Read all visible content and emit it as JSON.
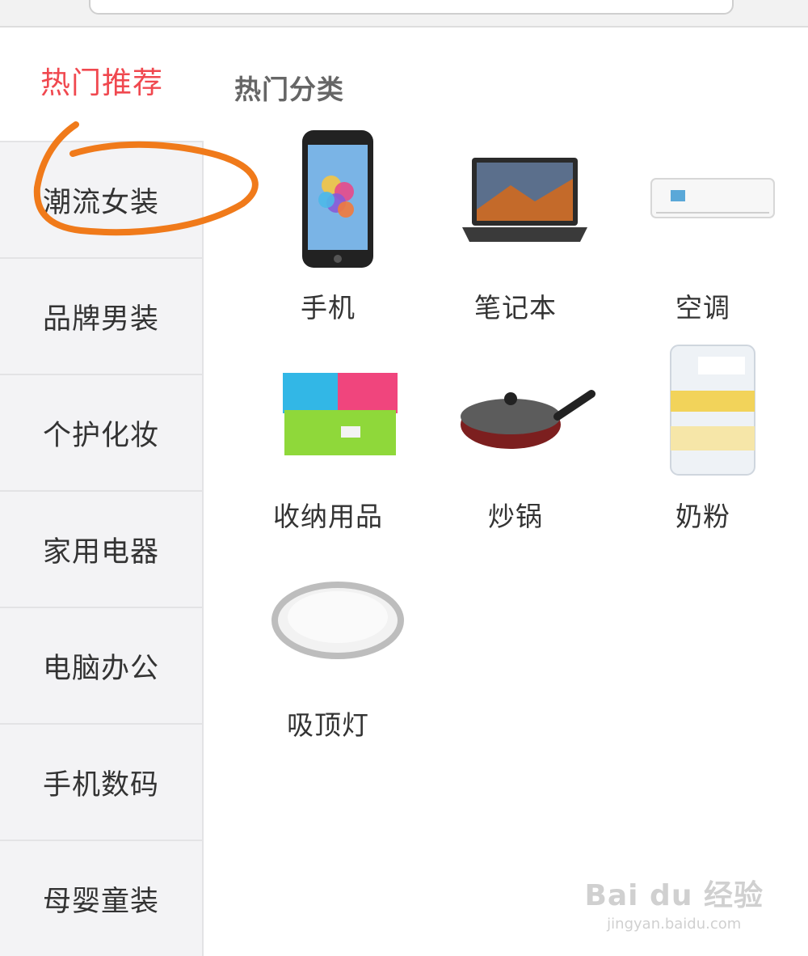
{
  "sidebar": {
    "active": "热门推荐",
    "items": [
      {
        "label": "潮流女装"
      },
      {
        "label": "品牌男装"
      },
      {
        "label": "个护化妆"
      },
      {
        "label": "家用电器"
      },
      {
        "label": "电脑办公"
      },
      {
        "label": "手机数码"
      },
      {
        "label": "母婴童装"
      }
    ]
  },
  "main": {
    "section_title": "热门分类",
    "products": [
      {
        "label": "手机",
        "icon": "smartphone-image"
      },
      {
        "label": "笔记本",
        "icon": "laptop-image"
      },
      {
        "label": "空调",
        "icon": "air-conditioner-image"
      },
      {
        "label": "收纳用品",
        "icon": "storage-box-image"
      },
      {
        "label": "炒锅",
        "icon": "wok-image"
      },
      {
        "label": "奶粉",
        "icon": "milk-powder-image"
      },
      {
        "label": "吸顶灯",
        "icon": "ceiling-lamp-image"
      }
    ]
  },
  "colors": {
    "accent": "#f0484f",
    "annotation": "#f07a1a",
    "sidebar_bg": "#f3f3f5"
  },
  "watermark": {
    "logo": "Bai du 经验",
    "url": "jingyan.baidu.com"
  }
}
